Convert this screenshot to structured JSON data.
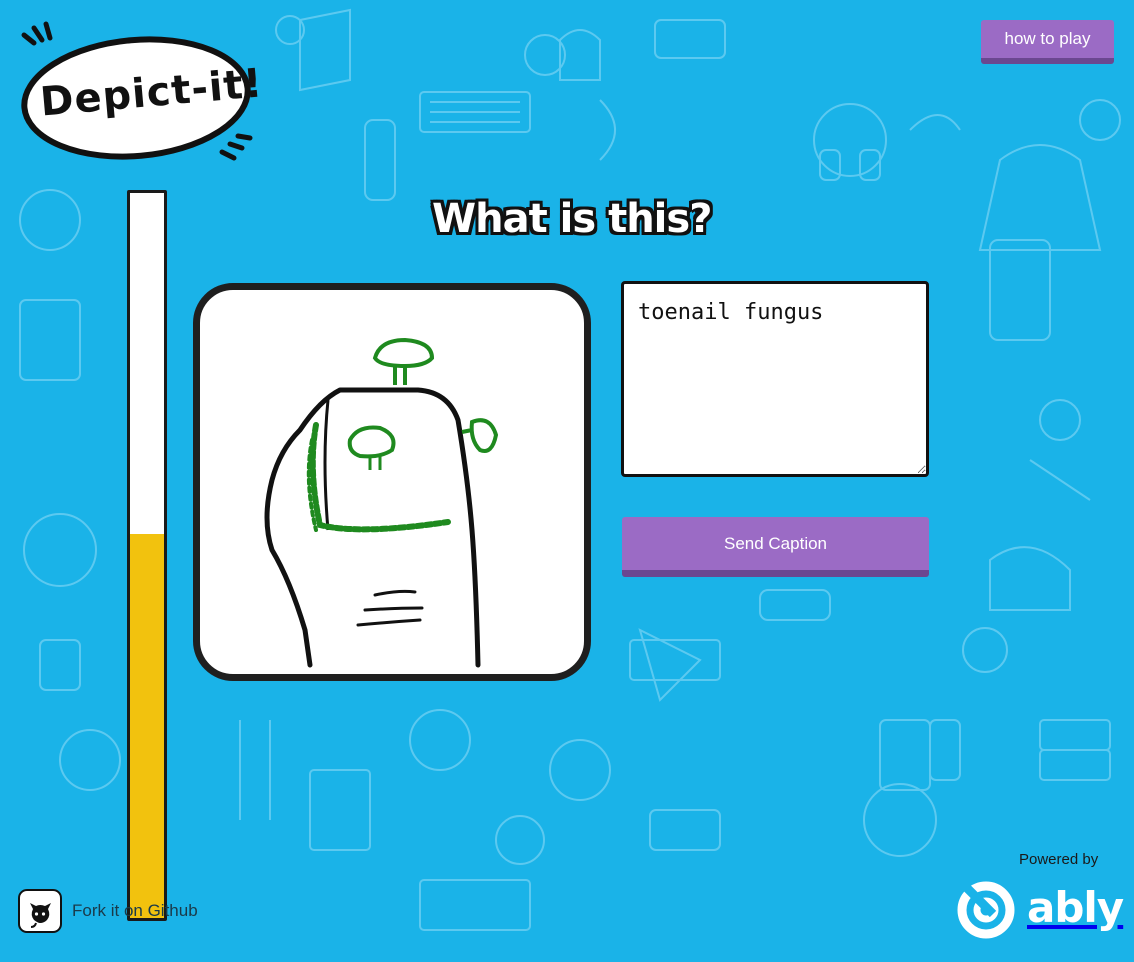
{
  "app": {
    "logo_text": "Depict-it!"
  },
  "header": {
    "how_to_play_label": "how to play"
  },
  "timer": {
    "remaining_fraction": 0.53,
    "fill_color": "#f2c20e"
  },
  "main": {
    "question": "What is this?",
    "caption_value": "toenail fungus",
    "send_label": "Send Caption"
  },
  "footer": {
    "github_label": "Fork it on Github",
    "powered_by": "Powered by",
    "brand": "ably"
  },
  "colors": {
    "background": "#1ab3e8",
    "button": "#9b6bc5",
    "button_shadow": "#6b4790",
    "drawing_green": "#1f8a1f"
  },
  "icons": {
    "github": "github-octocat-icon",
    "ably": "ably-logo-icon"
  }
}
